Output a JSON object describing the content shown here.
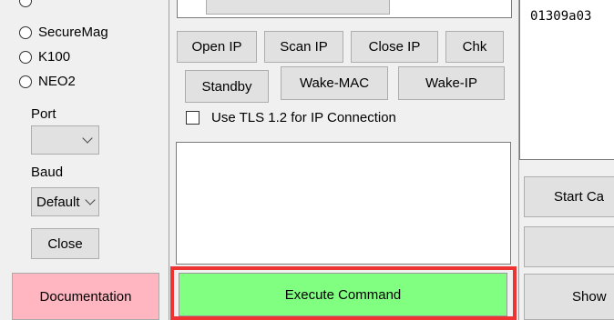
{
  "left_panel": {
    "radio_options": [
      "SecureMag",
      "K100",
      "NEO2"
    ],
    "port_label": "Port",
    "port_value": "",
    "baud_label": "Baud",
    "baud_value": "Default",
    "close_label": "Close",
    "documentation_label": "Documentation"
  },
  "middle_panel": {
    "buttons_row1": [
      "Open IP",
      "Scan IP",
      "Close IP",
      "Chk"
    ],
    "buttons_row2": [
      "Standby",
      "Wake-MAC",
      "Wake-IP"
    ],
    "tls_checkbox_label": "Use TLS 1.2 for IP Connection",
    "tls_checked": false,
    "output_text": "",
    "execute_label": "Execute Command",
    "execute_color": "#80ff80",
    "highlight_color": "#ee3333"
  },
  "right_panel": {
    "hex_text": "01309a03",
    "start_label": "Start Ca",
    "show_label": "Show"
  }
}
